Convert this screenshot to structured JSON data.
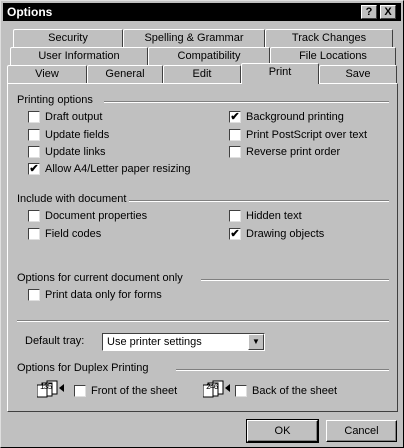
{
  "window": {
    "title": "Options",
    "help_btn": "?",
    "close_btn": "X"
  },
  "tabs": {
    "row1": [
      "Security",
      "Spelling & Grammar",
      "Track Changes"
    ],
    "row2": [
      "User Information",
      "Compatibility",
      "File Locations"
    ],
    "row3": [
      "View",
      "General",
      "Edit",
      "Print",
      "Save"
    ],
    "active": "Print"
  },
  "printing_options": {
    "label": "Printing options",
    "left": [
      {
        "label": "Draft output",
        "checked": false
      },
      {
        "label": "Update fields",
        "checked": false
      },
      {
        "label": "Update links",
        "checked": false
      },
      {
        "label": "Allow A4/Letter paper resizing",
        "checked": true
      }
    ],
    "right": [
      {
        "label": "Background printing",
        "checked": true
      },
      {
        "label": "Print PostScript over text",
        "checked": false
      },
      {
        "label": "Reverse print order",
        "checked": false
      }
    ]
  },
  "include_with_document": {
    "label": "Include with document",
    "left": [
      {
        "label": "Document properties",
        "checked": false
      },
      {
        "label": "Field codes",
        "checked": false
      }
    ],
    "right": [
      {
        "label": "Hidden text",
        "checked": false
      },
      {
        "label": "Drawing objects",
        "checked": true
      }
    ]
  },
  "current_document": {
    "label": "Options for current document only",
    "items": [
      {
        "label": "Print data only for forms",
        "checked": false
      }
    ]
  },
  "default_tray": {
    "label": "Default tray:",
    "value": "Use printer settings"
  },
  "duplex": {
    "label": "Options for Duplex Printing",
    "front": {
      "label": "Front of the sheet",
      "checked": false,
      "icon_text": "135"
    },
    "back": {
      "label": "Back of the sheet",
      "checked": false,
      "icon_text": "246"
    }
  },
  "buttons": {
    "ok": "OK",
    "cancel": "Cancel"
  },
  "check_glyph": "✔"
}
